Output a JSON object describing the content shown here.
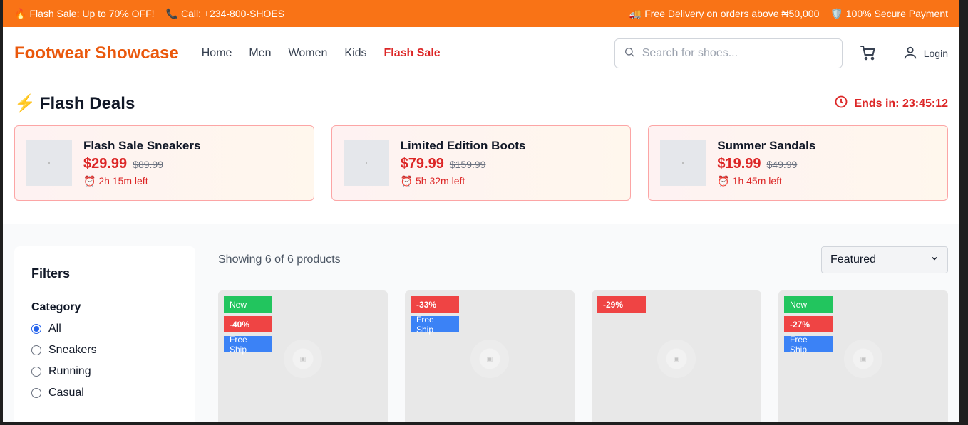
{
  "promo": {
    "left": [
      {
        "icon": "🔥",
        "icon_name": "fire-icon",
        "text": "Flash Sale: Up to 70% OFF!"
      },
      {
        "icon": "📞",
        "icon_name": "phone-icon",
        "text": "Call: +234-800-SHOES"
      }
    ],
    "right": [
      {
        "icon": "🚚",
        "icon_name": "truck-icon",
        "text": "Free Delivery on orders above ₦50,000"
      },
      {
        "icon": "🛡️",
        "icon_name": "shield-icon",
        "text": "100% Secure Payment"
      }
    ]
  },
  "header": {
    "logo": "Footwear Showcase",
    "nav": [
      "Home",
      "Men",
      "Women",
      "Kids",
      "Flash Sale"
    ],
    "search_placeholder": "Search for shoes...",
    "login": "Login"
  },
  "flash": {
    "title": "Flash Deals",
    "ends_label": "Ends in: 23:45:12",
    "deals": [
      {
        "name": "Flash Sale Sneakers",
        "price": "$29.99",
        "old_price": "$89.99",
        "time": "2h 15m left"
      },
      {
        "name": "Limited Edition Boots",
        "price": "$79.99",
        "old_price": "$159.99",
        "time": "5h 32m left"
      },
      {
        "name": "Summer Sandals",
        "price": "$19.99",
        "old_price": "$49.99",
        "time": "1h 45m left"
      }
    ]
  },
  "filters": {
    "title": "Filters",
    "category_label": "Category",
    "options": [
      "All",
      "Sneakers",
      "Running",
      "Casual"
    ],
    "selected": "All"
  },
  "products": {
    "count_text": "Showing 6 of 6 products",
    "sort": "Featured",
    "cards": [
      {
        "badges": [
          {
            "type": "new",
            "text": "New"
          },
          {
            "type": "off",
            "text": "-40%"
          },
          {
            "type": "ship",
            "text": "Free Ship"
          }
        ]
      },
      {
        "badges": [
          {
            "type": "off",
            "text": "-33%"
          },
          {
            "type": "ship",
            "text": "Free Ship"
          }
        ]
      },
      {
        "badges": [
          {
            "type": "off",
            "text": "-29%"
          }
        ]
      },
      {
        "badges": [
          {
            "type": "new",
            "text": "New"
          },
          {
            "type": "off",
            "text": "-27%"
          },
          {
            "type": "ship",
            "text": "Free Ship"
          }
        ]
      }
    ]
  },
  "colors": {
    "promo_bg": "#f97316",
    "brand": "#ea580c",
    "sale": "#dc2626",
    "new_badge": "#22c55e",
    "discount_badge": "#ef4444",
    "ship_badge": "#3b82f6"
  }
}
